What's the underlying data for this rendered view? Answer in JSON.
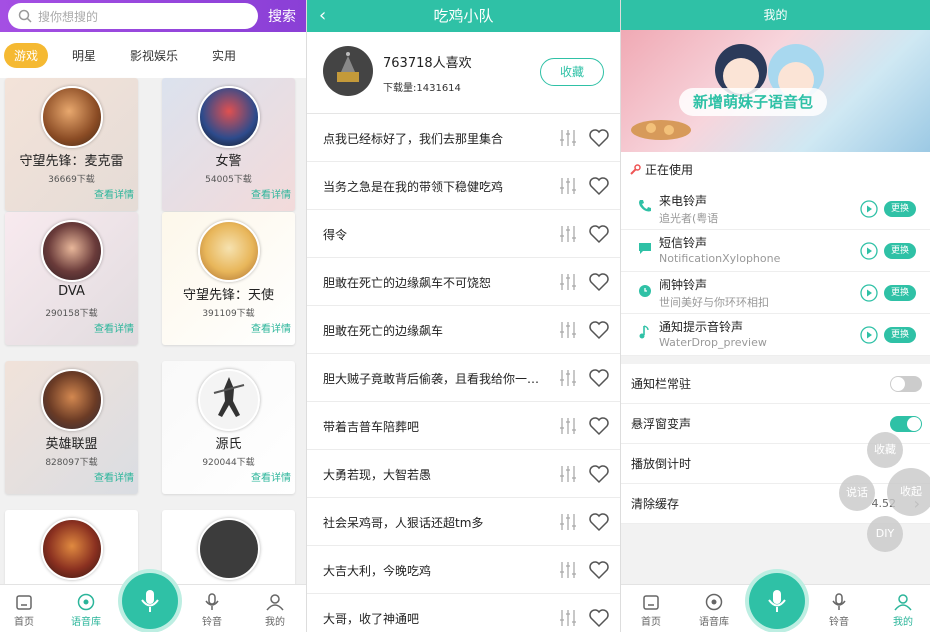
{
  "panel1": {
    "search": {
      "placeholder": "搜你想搜的",
      "button": "搜索"
    },
    "tabs": [
      "游戏",
      "明星",
      "影视娱乐",
      "实用"
    ],
    "cards": [
      {
        "name": "守望先锋：麦克雷",
        "downloads": "36669下载",
        "detail": "查看详情"
      },
      {
        "name": "女警",
        "downloads": "54005下载",
        "detail": "查看详情"
      },
      {
        "name": "DVA",
        "downloads": "290158下载",
        "detail": "查看详情"
      },
      {
        "name": "守望先锋：天使",
        "downloads": "391109下载",
        "detail": "查看详情"
      },
      {
        "name": "英雄联盟",
        "downloads": "828097下载",
        "detail": "查看详情"
      },
      {
        "name": "源氏",
        "downloads": "920044下载",
        "detail": "查看详情"
      }
    ],
    "nav": {
      "home": "首页",
      "library": "语音库",
      "ringtone": "铃音",
      "mine": "我的"
    }
  },
  "panel2": {
    "title": "吃鸡小队",
    "likes": "763718人喜欢",
    "downloads": "下载量:1431614",
    "favorite": "收藏",
    "sounds": [
      "点我已经标好了，我们去那里集合",
      "当务之急是在我的带领下稳健吃鸡",
      "得令",
      "胆敢在死亡的边缘飙车不可饶恕",
      "胆敢在死亡的边缘飙车",
      "胆大贼子竟敢背后偷袭，且看我给你一个…",
      "带着吉普车陪葬吧",
      "大勇若现，大智若愚",
      "社会呆鸡哥，人狠话还超tm多",
      "大吉大利，今晚吃鸡",
      "大哥，收了神通吧"
    ]
  },
  "panel3": {
    "title": "我的",
    "banner": "新增萌妹子语音包",
    "in_use": "正在使用",
    "ringtones": [
      {
        "label": "来电铃声",
        "value": "追光者(粤语"
      },
      {
        "label": "短信铃声",
        "value": "NotificationXylophone"
      },
      {
        "label": "闹钟铃声",
        "value": "世间美好与你环环相扣"
      },
      {
        "label": "通知提示音铃声",
        "value": "WaterDrop_preview"
      }
    ],
    "change": "更换",
    "settings": {
      "notify": "通知栏常驻",
      "float": "悬浮窗变声",
      "timer": "播放倒计时",
      "cache": "清除缓存",
      "cache_size": "4.52"
    },
    "floating": {
      "fav": "收藏",
      "speak": "说话",
      "collapse": "收起",
      "diy": "DIY"
    },
    "nav": {
      "home": "首页",
      "library": "语音库",
      "ringtone": "铃音",
      "mine": "我的"
    }
  }
}
